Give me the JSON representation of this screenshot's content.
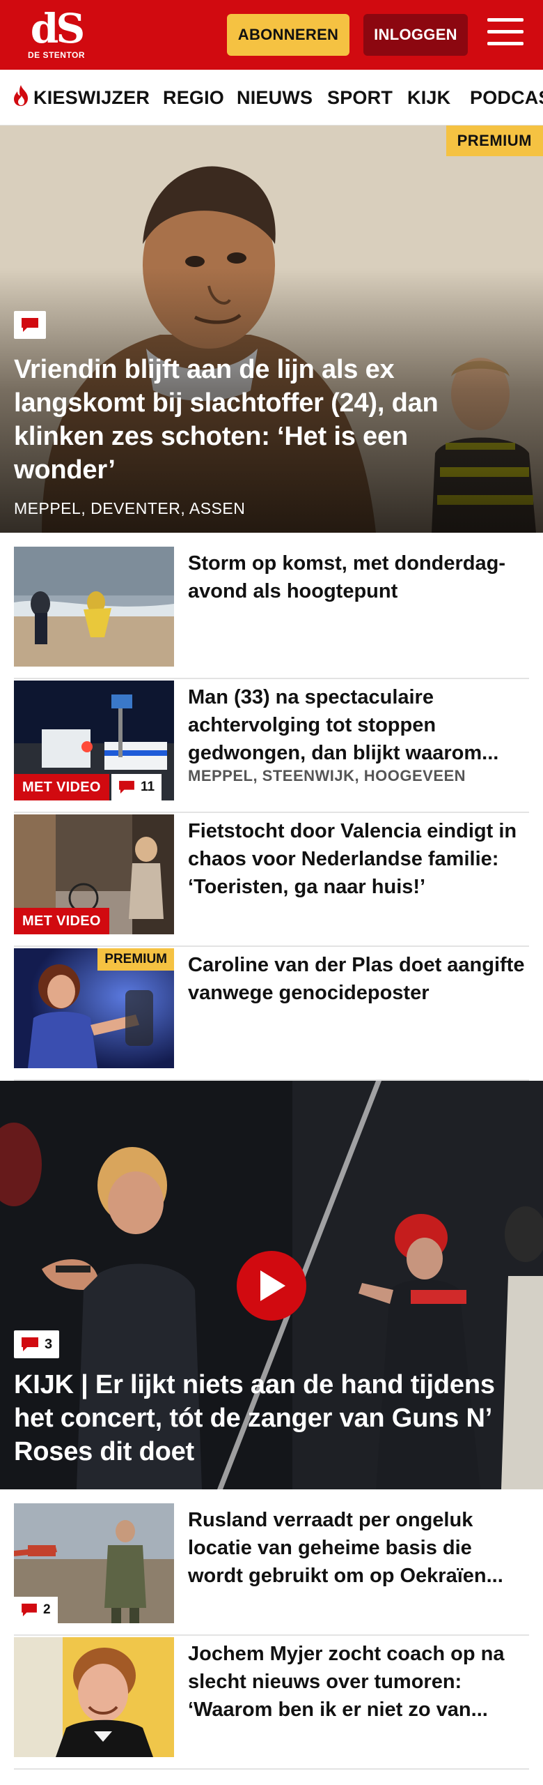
{
  "header": {
    "logo_mark": "dS",
    "logo_sub": "DE STENTOR",
    "subscribe_label": "ABONNEREN",
    "login_label": "INLOGGEN"
  },
  "nav": {
    "items": [
      {
        "label": "KIESWIJZER",
        "icon": "flame-icon"
      },
      {
        "label": "REGIO"
      },
      {
        "label": "NIEUWS"
      },
      {
        "label": "SPORT"
      },
      {
        "label": "KIJK"
      },
      {
        "label": "PODCAS"
      }
    ]
  },
  "hero": {
    "badge": "PREMIUM",
    "title": "Vriendin blijft aan de lijn als ex langskomt bij slachtoffer (24), dan klinken zes schoten: ‘Het is een wonder’",
    "meta": "MEPPEL, DEVENTER, ASSEN",
    "comment_icon": "comment-icon"
  },
  "articles": [
    {
      "title": "Storm op komst, met donderdag­avond als hoogtepunt",
      "meta": ""
    },
    {
      "title": "Man (33) na spectaculaire achtervolging tot stoppen gedwongen, dan blijkt waarom...",
      "meta": "MEPPEL, STEENWIJK, HOOGEVEEN",
      "video_label": "MET VIDEO",
      "comments": "11"
    },
    {
      "title": "Fietstocht door Valencia eindigt in chaos voor Nederlandse familie: ‘Toeristen, ga naar huis!’",
      "meta": "",
      "video_label": "MET VIDEO"
    },
    {
      "title": "Caroline van der Plas doet aangifte vanwege genocidepos­ter",
      "meta": "",
      "premium": "PREMIUM"
    }
  ],
  "video_hero": {
    "comments": "3",
    "title": "KIJK | Er lijkt niets aan de hand tijdens het concert, tót de zanger van Guns N’ Roses dit doet"
  },
  "articles2": [
    {
      "title": "Rusland verraadt per ongeluk locatie van geheime basis die wordt gebruikt om op Oekraïen...",
      "comments": "2"
    },
    {
      "title": "Jochem Myjer zocht coach op na slecht nieuws over tumoren: ‘Waarom ben ik er niet zo van..."
    }
  ],
  "colors": {
    "brand_red": "#d10a10",
    "dark_red": "#8c0710",
    "premium_yellow": "#f5c242"
  }
}
